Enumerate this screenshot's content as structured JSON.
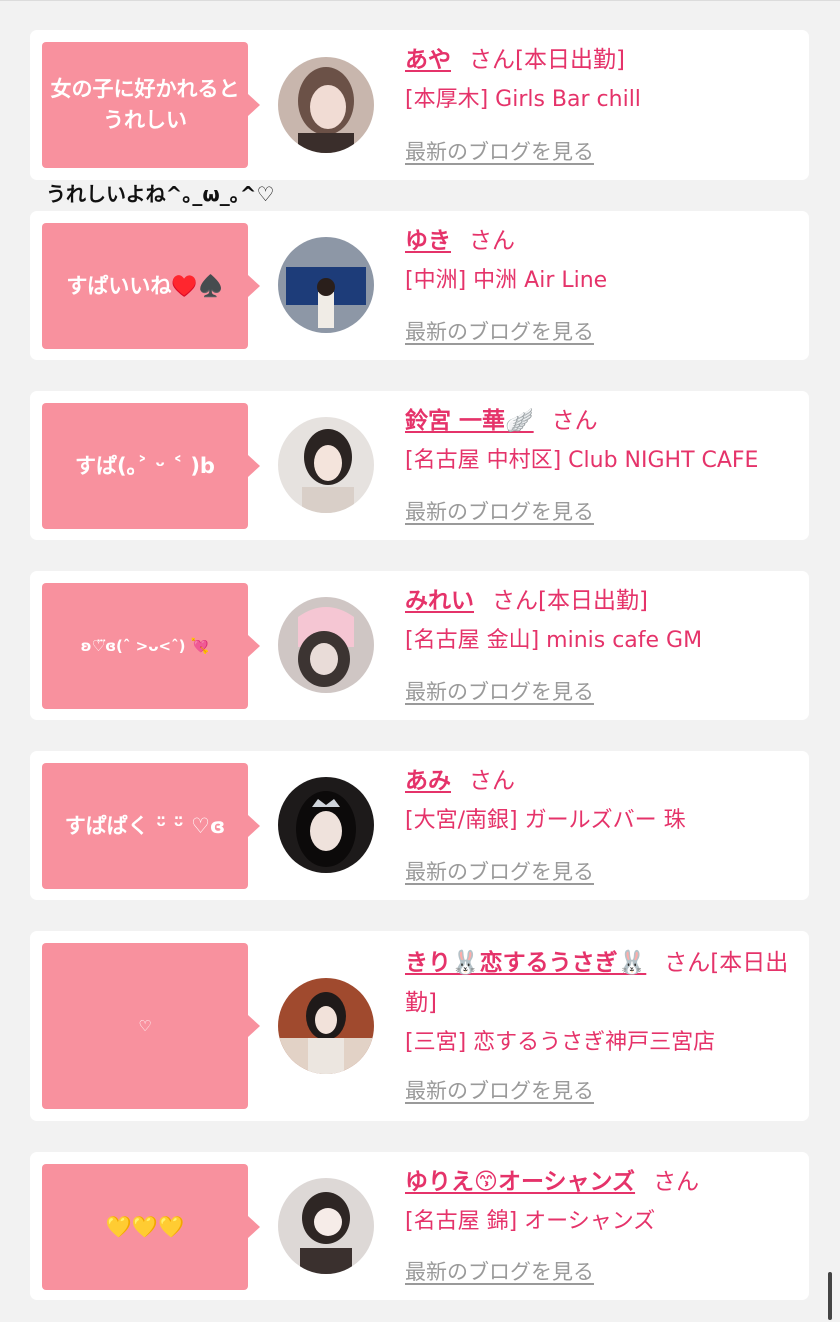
{
  "posts": [
    {
      "comment": "女の子に好かれるとうれしい",
      "name": "あや",
      "suffix": "さん[本日出勤]",
      "shop": "[本厚木] Girls Bar chill",
      "blog_link": "最新のブログを見る"
    },
    {
      "comment": "すぱいいね♥️♠️",
      "name": "ゆき",
      "suffix": "さん",
      "shop": "[中洲] 中洲 Air Line",
      "blog_link": "最新のブログを見る"
    },
    {
      "comment": "すぱ(｡˃ ᵕ ˂ )b",
      "name": "鈴宮 一華🪽",
      "suffix": "さん",
      "shop": "[名古屋 中村区] Club NIGHT CAFE",
      "blog_link": "最新のブログを見る"
    },
    {
      "comment": "ʚ♡⃛ɞ(ˆ >ᴗ<ˆ) 💘",
      "name": "みれい",
      "suffix": "さん[本日出勤]",
      "shop": "[名古屋 金山] minis cafe GM",
      "blog_link": "最新のブログを見る"
    },
    {
      "comment": "すぱぱく ᵕ̈ ᵕ̈ ♡ɞ",
      "name": "あみ",
      "suffix": "さん",
      "shop": "[大宮/南銀] ガールズバー 珠",
      "blog_link": "最新のブログを見る"
    },
    {
      "comment": "♡",
      "name": "きり🐰恋するうさぎ🐰",
      "suffix": "さん[本日出勤]",
      "shop": "[三宮] 恋するうさぎ神戸三宮店",
      "blog_link": "最新のブログを見る"
    },
    {
      "comment": "💛💛💛",
      "name": "ゆりえ😙オーシャンズ",
      "suffix": "さん",
      "shop": "[名古屋 錦] オーシャンズ",
      "blog_link": "最新のブログを見る"
    }
  ],
  "between_text": "うれしいよね^｡_ω_｡^♡",
  "colors": {
    "accent": "#e5336a",
    "bubble": "#f8919e",
    "link": "#9a9a9a",
    "background": "#f2f2f2"
  }
}
